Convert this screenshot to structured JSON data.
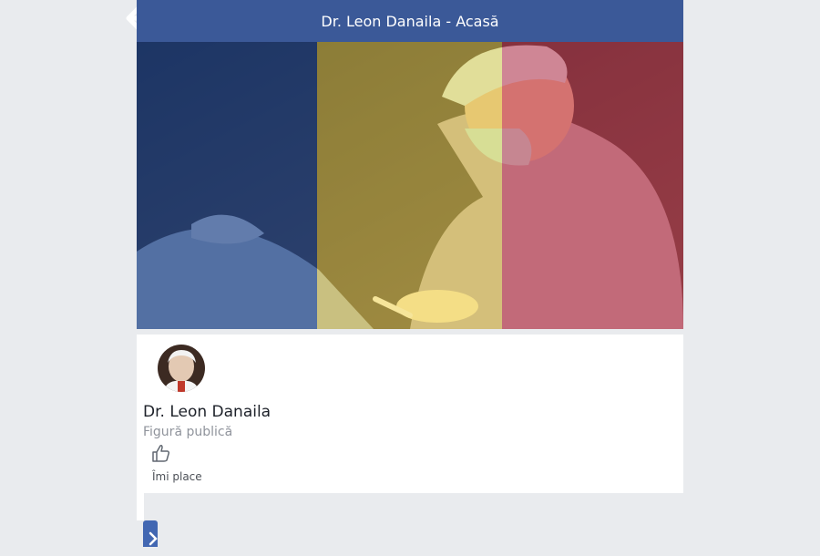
{
  "header": {
    "title": "Dr. Leon Danaila - Acasă"
  },
  "icons": {
    "back": "arrow-left-icon",
    "like": "thumbs-up-icon",
    "action": "chevron-right-icon"
  },
  "profile": {
    "name": "Dr. Leon Danaila",
    "category": "Figură publică",
    "like_label": "Îmi place"
  },
  "colors": {
    "header_bg": "#3b5998",
    "page_bg": "#e9ebee",
    "flag_blue": "#002b7f",
    "flag_yellow": "#fcd116",
    "flag_red": "#ce1126"
  }
}
